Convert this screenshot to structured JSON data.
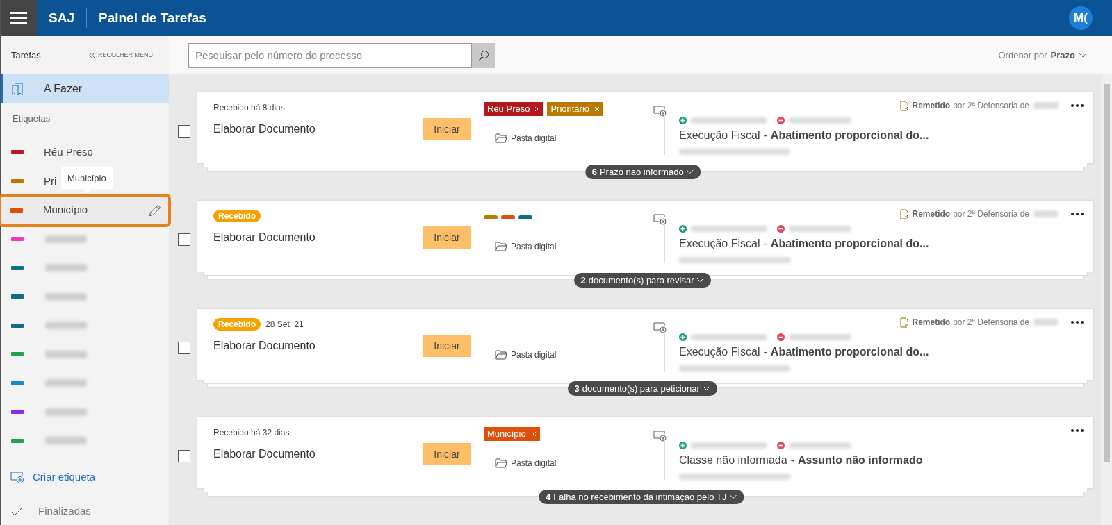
{
  "header": {
    "brand": "SAJ",
    "title": "Painel de Tarefas",
    "avatar": "M("
  },
  "sidebar": {
    "heading": "Tarefas",
    "collapse": "RECOLHER MENU",
    "nav": [
      {
        "label": "A Fazer",
        "selected": true
      }
    ],
    "labels_heading": "Etiquetas",
    "labels": [
      {
        "label": "Réu Preso",
        "color": "#b3191c",
        "highlighted": false
      },
      {
        "label": "Pri",
        "color": "#b97a00",
        "highlighted": false
      },
      {
        "label": "Município",
        "color": "#e04e0c",
        "highlighted": true
      },
      {
        "color": "#ea3ab8",
        "highlighted": false
      },
      {
        "color": "#0b6e82",
        "highlighted": false
      },
      {
        "color": "#0b6e82",
        "highlighted": false
      },
      {
        "color": "#0b6e82",
        "highlighted": false
      },
      {
        "color": "#22a04b",
        "highlighted": false
      },
      {
        "color": "#1b88d6",
        "highlighted": false
      },
      {
        "color": "#8e2be2",
        "highlighted": false
      },
      {
        "color": "#22a04b",
        "highlighted": false
      }
    ],
    "tooltip": "Município",
    "create": "Criar etiqueta",
    "finished": "Finalizadas"
  },
  "toolbar": {
    "search_placeholder": "Pesquisar pelo número do processo",
    "sort_label": "Ordenar por",
    "sort_value": "Prazo"
  },
  "tasks": [
    {
      "checked": false,
      "status": {
        "kind": "text",
        "text": "Recebido há 8 dias"
      },
      "title": "Elaborar Documento",
      "button": "Iniciar",
      "tags": [
        {
          "kind": "chip",
          "label": "Réu Preso",
          "color": "#b3191c"
        },
        {
          "kind": "chip",
          "label": "Prioritário",
          "color": "#b97a00"
        }
      ],
      "folder": "Pasta digital",
      "remetido": {
        "action": "Remetido",
        "text": "por 2ª Defensoria de"
      },
      "class": "Execução Fiscal",
      "separator": "-",
      "subject": "Abatimento proporcional do...",
      "pill_count": "6",
      "pill_text": "Prazo não informado"
    },
    {
      "checked": false,
      "status": {
        "kind": "badge",
        "text": "Recebido"
      },
      "title": "Elaborar Documento",
      "button": "Iniciar",
      "tags": [
        {
          "kind": "dot",
          "color": "#b97a00"
        },
        {
          "kind": "dot",
          "color": "#e04e0c"
        },
        {
          "kind": "dot",
          "color": "#0b6e82"
        }
      ],
      "folder": "Pasta digital",
      "remetido": {
        "action": "Remetido",
        "text": "por 2ª Defensoria de"
      },
      "class": "Execução Fiscal",
      "separator": "-",
      "subject": "Abatimento proporcional do...",
      "pill_count": "2",
      "pill_text": "documento(s) para revisar"
    },
    {
      "checked": false,
      "status": {
        "kind": "badge",
        "text": "Recebido"
      },
      "date": "28 Set. 21",
      "title": "Elaborar Documento",
      "button": "Iniciar",
      "folder": "Pasta digital",
      "remetido": {
        "action": "Remetido",
        "text": "por 2ª Defensoria de"
      },
      "class": "Execução Fiscal",
      "separator": "-",
      "subject": "Abatimento proporcional do...",
      "pill_count": "3",
      "pill_text": "documento(s) para peticionar"
    },
    {
      "checked": false,
      "status": {
        "kind": "text",
        "text": "Recebido há 32 dias"
      },
      "title": "Elaborar Documento",
      "button": "Iniciar",
      "tags": [
        {
          "kind": "chip",
          "label": "Município",
          "color": "#e04e0c"
        }
      ],
      "folder": "Pasta digital",
      "class": "Classe não informada",
      "separator": "-",
      "subject": "Assunto não informado",
      "pill_count": "4",
      "pill_text": "Falha no recebimento da intimação pelo TJ"
    }
  ]
}
